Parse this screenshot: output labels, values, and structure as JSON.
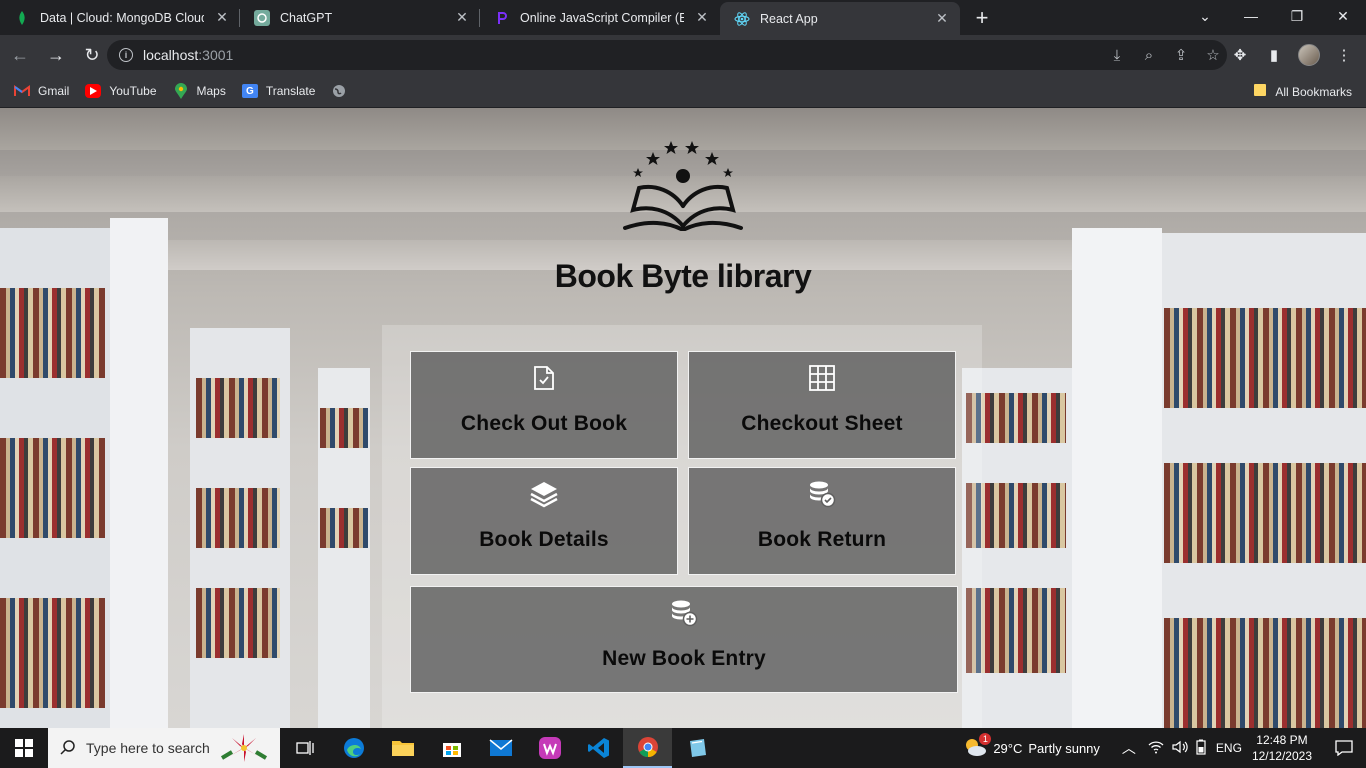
{
  "browser": {
    "tabs": [
      {
        "title": "Data | Cloud: MongoDB Cloud",
        "icon": "mongodb-leaf-icon",
        "color": "#13aa52"
      },
      {
        "title": "ChatGPT",
        "icon": "chatgpt-icon",
        "color": "#74aa9c"
      },
      {
        "title": "Online JavaScript Compiler (Edito",
        "icon": "programiz-icon",
        "color": "#7b2ff7"
      },
      {
        "title": "React App",
        "icon": "react-icon",
        "color": "#61dafb"
      }
    ],
    "close_glyph": "✕",
    "new_tab_glyph": "+",
    "url_host": "localhost",
    "url_port": ":3001",
    "bookmarks": [
      {
        "label": "Gmail",
        "icon": "gmail-icon"
      },
      {
        "label": "YouTube",
        "icon": "youtube-icon"
      },
      {
        "label": "Maps",
        "icon": "maps-icon"
      },
      {
        "label": "Translate",
        "icon": "translate-icon"
      }
    ],
    "all_bookmarks": "All Bookmarks"
  },
  "app": {
    "title": "Book Byte library",
    "cards": [
      {
        "label": "Check Out Book",
        "icon": "file-check-icon"
      },
      {
        "label": "Checkout Sheet",
        "icon": "grid-table-icon"
      },
      {
        "label": "Book Details",
        "icon": "layers-icon"
      },
      {
        "label": "Book Return",
        "icon": "database-check-icon"
      },
      {
        "label": "New Book Entry",
        "icon": "database-add-icon"
      }
    ]
  },
  "taskbar": {
    "search_placeholder": "Type here to search",
    "weather_temp": "29°C",
    "weather_desc": "Partly sunny",
    "weather_badge": "1",
    "language": "ENG",
    "time": "12:48 PM",
    "date": "12/12/2023"
  }
}
